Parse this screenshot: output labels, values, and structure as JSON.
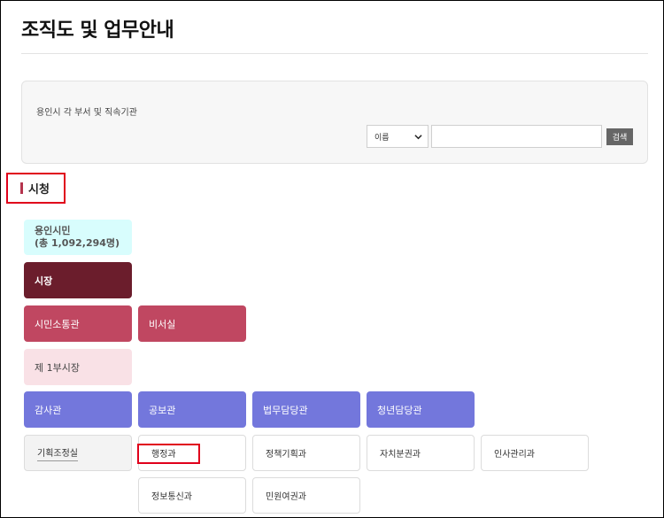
{
  "page_title": "조직도 및 업무안내",
  "search": {
    "description": "용인시 각 부서 및 직속기관",
    "select_value": "이름",
    "input_value": "",
    "button_label": "검색"
  },
  "section": {
    "label": "시청"
  },
  "org": {
    "citizen_line1": "용인시민",
    "citizen_line2": "(총 1,092,294명)",
    "mayor": "시장",
    "communication": "시민소통관",
    "secretary": "비서실",
    "vice_mayor": "제 1부시장",
    "audit": "감사관",
    "public_relations": "공보관",
    "legal": "법무담당관",
    "youth": "청년담당관",
    "departments": {
      "planning": "기획조정실",
      "administration": "행정과",
      "policy_planning": "정책기획과",
      "autonomy": "자치분권과",
      "personnel": "인사관리과",
      "info_comm": "정보통신과",
      "civil_petition": "민원여권과"
    }
  },
  "colors": {
    "mayor": "#6b1d2c",
    "pink": "#c04761",
    "vice": "#f9e1e6",
    "purple": "#7377dc",
    "citizen": "#d8fdfd",
    "highlight": "#e0001b"
  }
}
